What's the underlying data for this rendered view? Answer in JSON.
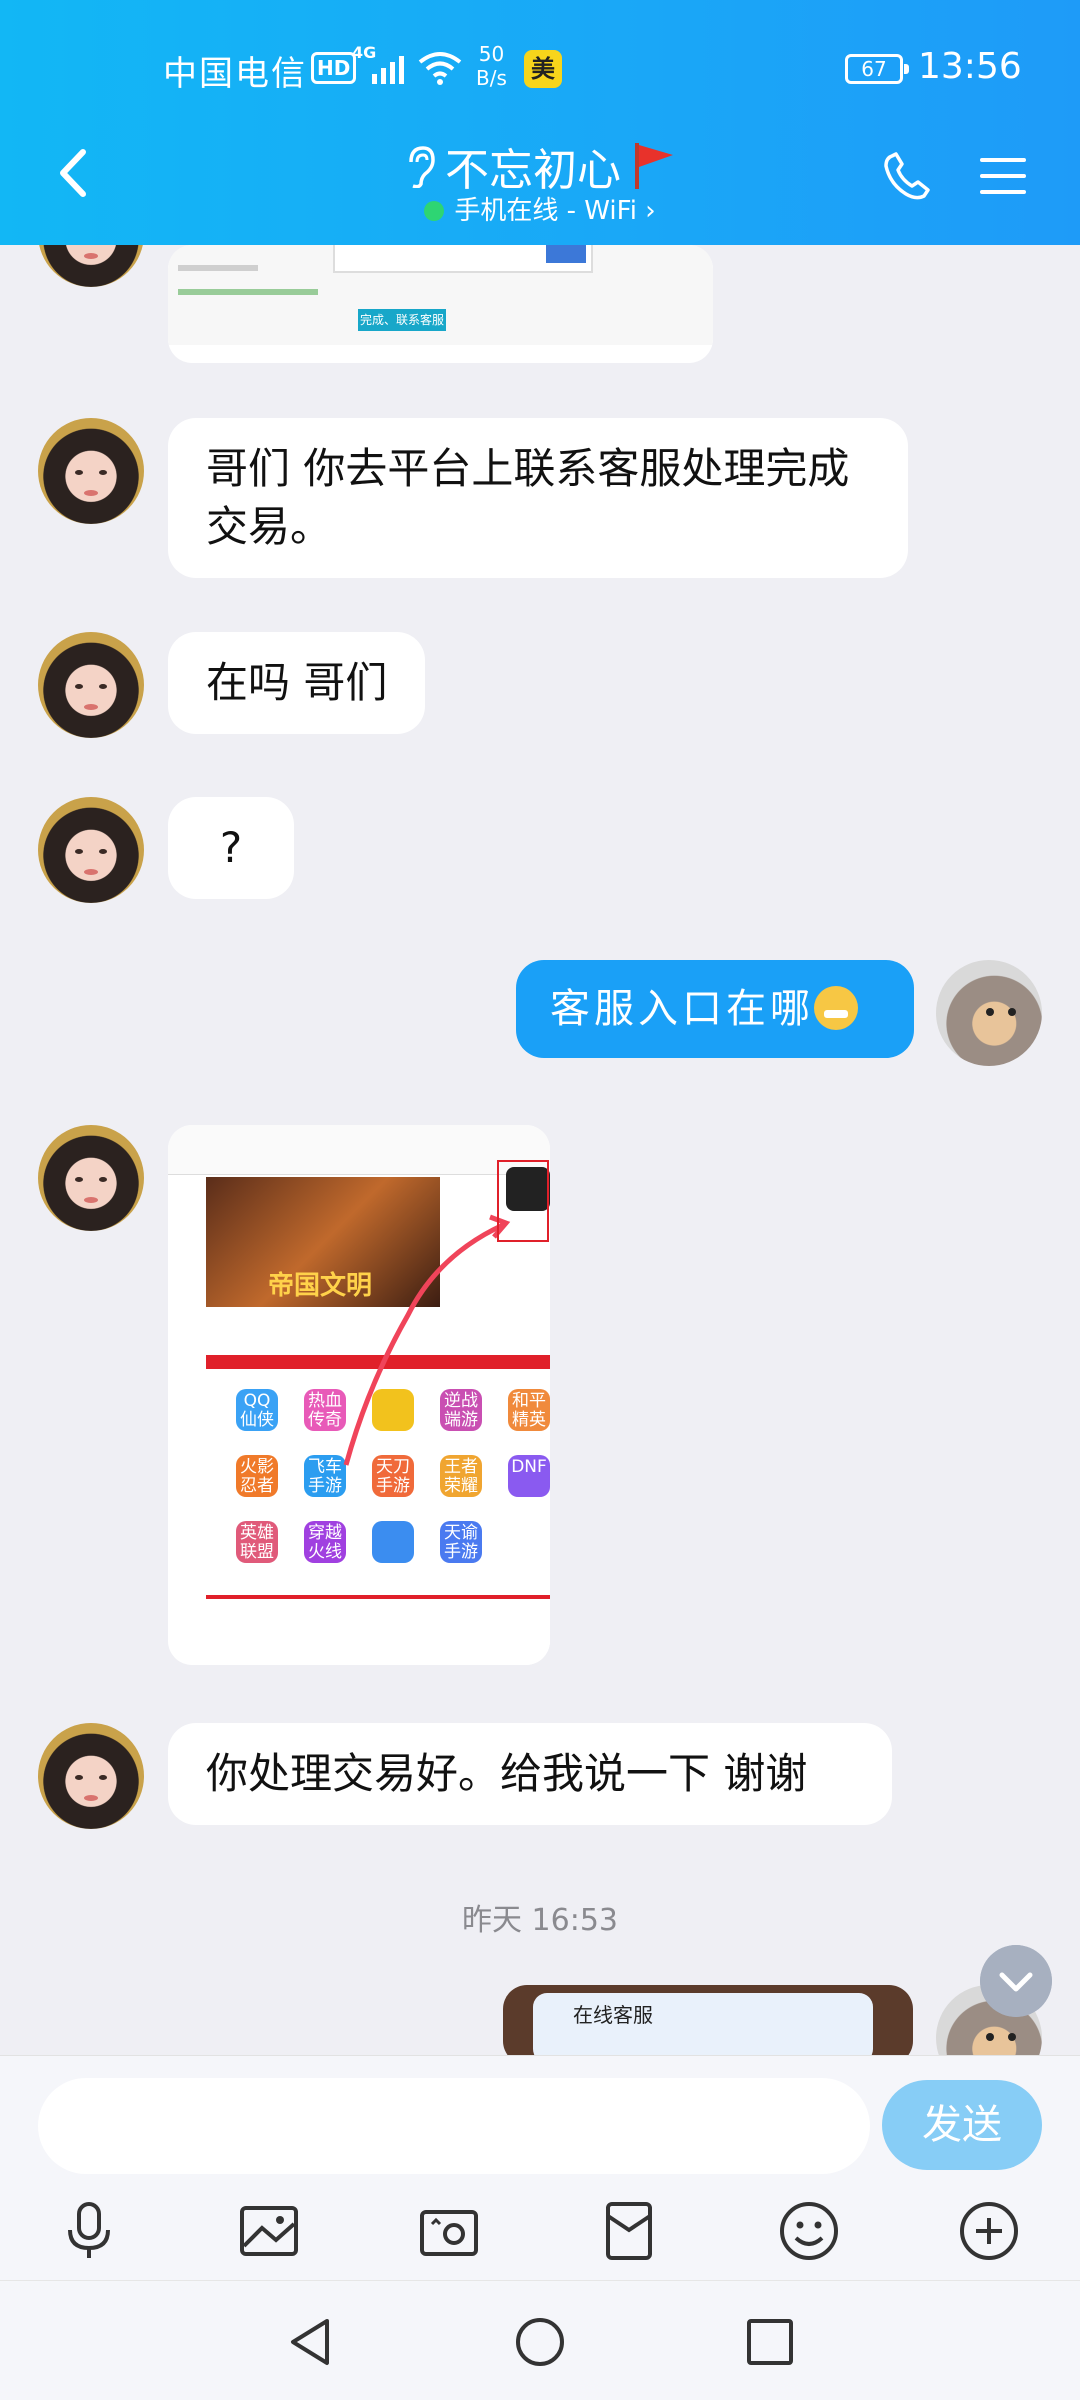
{
  "status_bar": {
    "carrier": "中国电信",
    "hd": "HD",
    "network": "4G",
    "speed_value": "50",
    "speed_unit": "B/s",
    "app_badge": "美",
    "battery": "67",
    "time": "13:56"
  },
  "header": {
    "title": "不忘初心",
    "subtitle": "手机在线 - WiFi ›"
  },
  "messages": [
    {
      "side": "left",
      "type": "image",
      "caption": "完成、联系客服"
    },
    {
      "side": "left",
      "type": "text",
      "text": "哥们 你去平台上联系客服处理完成交易。"
    },
    {
      "side": "left",
      "type": "text",
      "text": "在吗 哥们"
    },
    {
      "side": "left",
      "type": "text",
      "text": "?"
    },
    {
      "side": "right",
      "type": "text",
      "text": "客服入口在哪"
    },
    {
      "side": "left",
      "type": "image",
      "banner_text": "帝国文明",
      "tiles": [
        "QQ仙侠",
        "热血传奇",
        "",
        "逆战端游",
        "和平精英",
        "火影忍者",
        "飞车手游",
        "天刀手游",
        "王者荣耀",
        "DNF",
        "英雄联盟",
        "穿越火线",
        "",
        "天谕手游",
        ""
      ]
    },
    {
      "side": "left",
      "type": "text",
      "text": "你处理交易好。给我说一下 谢谢"
    },
    {
      "side": "right",
      "type": "image",
      "caption": "在线客服"
    }
  ],
  "timestamp": "昨天 16:53",
  "input": {
    "placeholder": "",
    "send_label": "发送"
  },
  "colors": {
    "header_gradient": "#12b7f5",
    "my_bubble": "#1aa0f7",
    "send_button": "#87cdf6"
  }
}
